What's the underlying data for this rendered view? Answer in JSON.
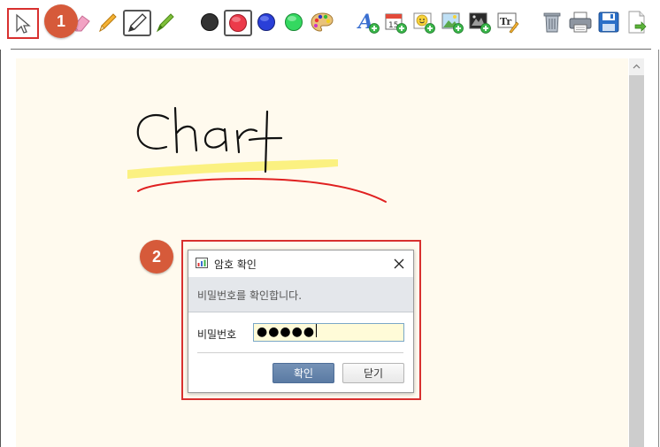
{
  "toolbar": {
    "tools": [
      {
        "name": "select-pointer-icon"
      },
      {
        "name": "eraser-icon"
      },
      {
        "name": "pencil-icon"
      },
      {
        "name": "pen-icon"
      },
      {
        "name": "highlighter-icon"
      }
    ],
    "colors": [
      {
        "name": "color-black",
        "hex": "#333333"
      },
      {
        "name": "color-red",
        "hex": "#e8283a"
      },
      {
        "name": "color-blue",
        "hex": "#2a3fd8"
      },
      {
        "name": "color-green",
        "hex": "#2fd65a"
      }
    ],
    "insert_tools": [
      "add-text-icon",
      "add-calendar-icon",
      "add-emoji-icon",
      "add-image-icon",
      "add-photo-icon",
      "text-format-icon"
    ],
    "file_tools": [
      "trash-icon",
      "print-icon",
      "save-icon",
      "export-icon"
    ],
    "calendar_number": "15"
  },
  "badges": {
    "step1": "1",
    "step2": "2"
  },
  "canvas": {
    "background": "#fffaee",
    "handwriting_text": "Chart",
    "highlight_color": "#fbf07a",
    "underline_color": "#e02020"
  },
  "dialog": {
    "title": "암호 확인",
    "message": "비밀번호를 확인합니다.",
    "password_label": "비밀번호",
    "password_value": "●●●●●",
    "ok_label": "확인",
    "close_label": "닫기"
  }
}
